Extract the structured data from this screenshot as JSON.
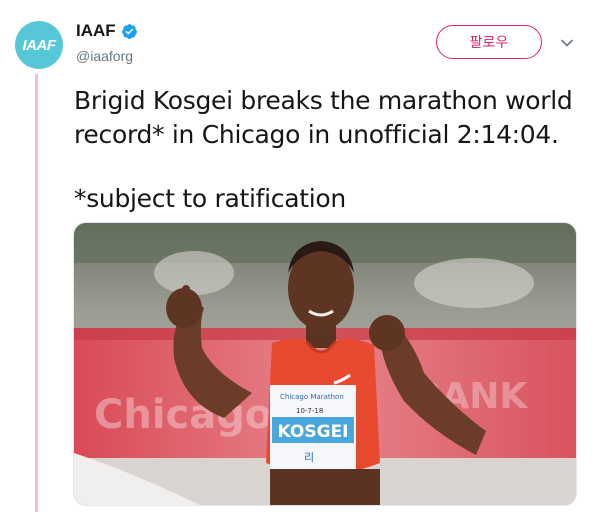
{
  "account": {
    "avatar_text": "IAAF",
    "display_name": "IAAF",
    "handle": "@iaaforg",
    "verified": true,
    "verified_icon": "verified-badge-icon"
  },
  "follow_button": {
    "label": "팔로우"
  },
  "menu": {
    "icon": "chevron-down-icon"
  },
  "tweet": {
    "text_line1": "Brigid Kosgei breaks the marathon world record* in Chicago in unofficial 2:14:04.",
    "text_line2": "*subject to ratification"
  },
  "media": {
    "bib_event": "Chicago Marathon",
    "bib_date": "10-7-18",
    "bib_name": "KOSGEI",
    "bib_small": "리"
  },
  "colors": {
    "accent": "#e0245e",
    "avatar_bg": "#55c7d6",
    "verified": "#1da1f2",
    "thread_line": "#f5c1c5"
  }
}
